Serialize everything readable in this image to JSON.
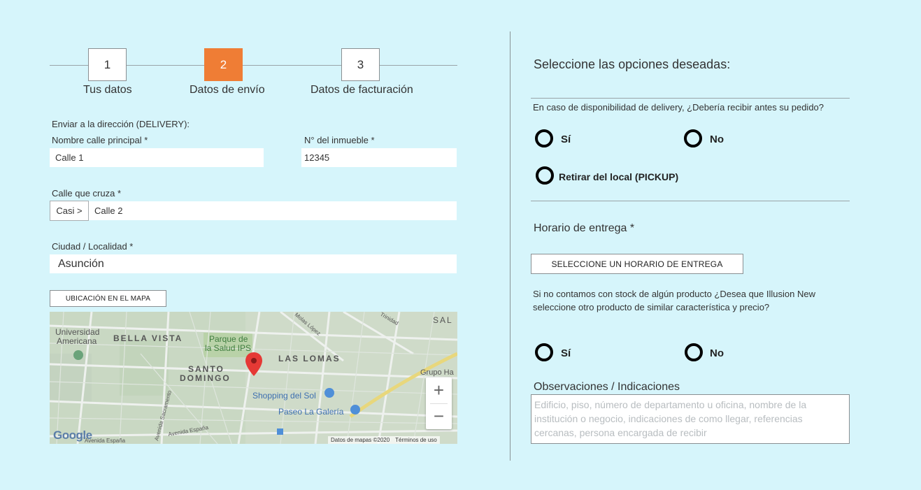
{
  "stepper": {
    "steps": [
      {
        "number": "1",
        "label": "Tus datos"
      },
      {
        "number": "2",
        "label": "Datos de envío"
      },
      {
        "number": "3",
        "label": "Datos de facturación"
      }
    ],
    "active_step": 2
  },
  "shipping": {
    "section_title": "Enviar a la dirección (DELIVERY):",
    "street": {
      "label": "Nombre calle principal *",
      "value": "Calle 1"
    },
    "number": {
      "label": "N° del inmueble *",
      "value": "12345"
    },
    "cross_street": {
      "label": "Calle que cruza *",
      "prefix": "Casi >",
      "value": "Calle 2"
    },
    "city": {
      "label": "Ciudad / Localidad *",
      "value": "Asunción"
    },
    "map_button": "UBICACIÓN EN EL MAPA"
  },
  "map": {
    "labels": {
      "universidad": "Universidad",
      "americana": "Americana",
      "bella_vista": "BELLA VISTA",
      "parque": "Parque de",
      "salud": "la Salud IPS",
      "santo": "SANTO",
      "domingo": "DOMINGO",
      "las_lomas": "LAS LOMAS",
      "shopping": "Shopping del Sol",
      "paseo": "Paseo La Galería",
      "grupo": "Grupo Ha",
      "sal": "SAL",
      "molas": "Molas López",
      "trinidad": "Trinidad",
      "espana1": "Avenida España",
      "espana2": "Avenida España",
      "sacramento": "Avenida Sacramento"
    },
    "zoom_in": "+",
    "zoom_out": "−",
    "logo": "Google",
    "data_credit": "Datos de mapas ©2020",
    "terms": "Términos de uso"
  },
  "options": {
    "title": "Seleccione las opciones deseadas:",
    "delivery_question": "En caso de disponibilidad de delivery, ¿Debería recibir antes su pedido?",
    "delivery_options": {
      "yes": "Sí",
      "no": "No",
      "pickup": "Retirar del local (PICKUP)"
    },
    "schedule_label": "Horario de entrega *",
    "schedule_button": "SELECCIONE UN HORARIO DE ENTREGA",
    "stock_question_line1": "Si no contamos con stock de algún producto ¿Desea que Illusion New",
    "stock_question_line2": "seleccione otro producto de similar característica y precio?",
    "stock_options": {
      "yes": "Sí",
      "no": "No"
    },
    "notes_label": "Observaciones / Indicaciones",
    "notes_placeholder": "Edificio, piso, número de departamento u oficina, nombre de la institución o negocio, indicaciones de como llegar, referencias cercanas, persona encargada de recibir"
  },
  "colors": {
    "background": "#d6f5fb",
    "accent": "#ef7d35"
  }
}
